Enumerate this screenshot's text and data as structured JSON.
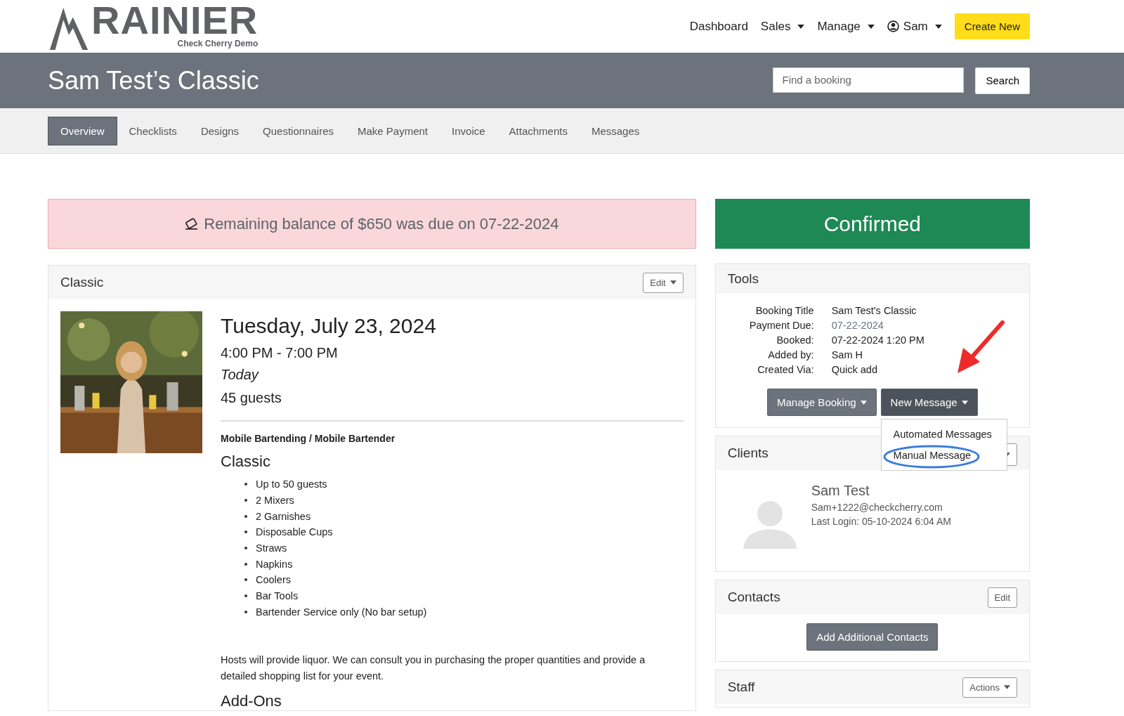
{
  "logo": {
    "name": "RAINIER",
    "subtitle": "Check Cherry Demo"
  },
  "top_nav": [
    {
      "label": "Dashboard",
      "dropdown": false,
      "kind": "link"
    },
    {
      "label": "Sales",
      "dropdown": true,
      "kind": "link"
    },
    {
      "label": "Manage",
      "dropdown": true,
      "kind": "link"
    },
    {
      "label": "Sam",
      "dropdown": true,
      "kind": "user"
    }
  ],
  "create_button": "Create New",
  "page_title": "Sam Test’s Classic",
  "search": {
    "placeholder": "Find a booking",
    "button": "Search"
  },
  "tabs": [
    {
      "label": "Overview",
      "selected": true
    },
    {
      "label": "Checklists",
      "selected": false
    },
    {
      "label": "Designs",
      "selected": false
    },
    {
      "label": "Questionnaires",
      "selected": false
    },
    {
      "label": "Make Payment",
      "selected": false
    },
    {
      "label": "Invoice",
      "selected": false
    },
    {
      "label": "Attachments",
      "selected": false
    },
    {
      "label": "Messages",
      "selected": false
    }
  ],
  "alert": "Remaining balance of $650 was due on 07-22-2024",
  "status": {
    "label": "Confirmed"
  },
  "package_card": {
    "title": "Classic",
    "edit_button": "Edit",
    "date": "Tuesday, July 23, 2024",
    "time": "4:00 PM - 7:00 PM",
    "relative_day": "Today",
    "guests": "45 guests",
    "category": "Mobile Bartending / Mobile Bartender",
    "package_name": "Classic",
    "features": [
      "Up to 50 guests",
      "2 Mixers",
      "2 Garnishes",
      "Disposable Cups",
      "Straws",
      "Napkins",
      "Coolers",
      "Bar Tools",
      "Bartender Service only (No bar setup)"
    ],
    "description": "Hosts will provide liquor. We can consult you in purchasing the proper quantities and provide a detailed shopping list for your event.",
    "addons_heading": "Add-Ons"
  },
  "tools": {
    "title": "Tools",
    "details": [
      {
        "label": "Booking Title",
        "value": "Sam Test's Classic",
        "muted": false
      },
      {
        "label": "Payment Due:",
        "value": "07-22-2024",
        "muted": true
      },
      {
        "label": "Booked:",
        "value": "07-22-2024 1:20 PM",
        "muted": false
      },
      {
        "label": "Added by:",
        "value": "Sam H",
        "muted": false
      },
      {
        "label": "Created Via:",
        "value": "Quick add",
        "muted": false
      }
    ],
    "buttons": [
      {
        "label": "Manage Booking",
        "expanded": false
      },
      {
        "label": "New Message",
        "expanded": true
      }
    ],
    "menu": [
      {
        "label": "Automated Messages",
        "highlighted": false
      },
      {
        "label": "Manual Message",
        "highlighted": true
      }
    ]
  },
  "clients": {
    "title": "Clients",
    "client": {
      "name": "Sam Test",
      "email": "Sam+1222@checkcherry.com",
      "last_login": "Last Login: 05-10-2024 6:04 AM"
    }
  },
  "contacts": {
    "title": "Contacts",
    "edit_button": "Edit",
    "add_button": "Add Additional Contacts"
  },
  "staff": {
    "title": "Staff",
    "actions_button": "Actions"
  }
}
